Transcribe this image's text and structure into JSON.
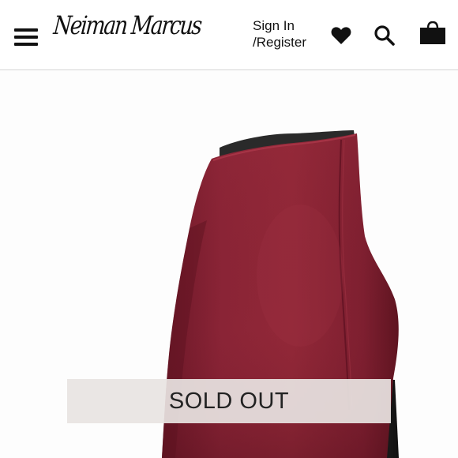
{
  "header": {
    "brand_logo_text": "Neiman Marcus",
    "sign_in_line1": "Sign In",
    "sign_in_line2": "/Register",
    "icons": {
      "menu": "hamburger-menu-icon",
      "wishlist": "heart-icon",
      "search": "search-icon",
      "cart": "shopping-bag-icon"
    }
  },
  "product": {
    "image_alt": "burgundy suede ankle boot",
    "status_label": "SOLD OUT"
  },
  "colors": {
    "boot_suede": "#8e2535",
    "boot_shadow": "#6a1525",
    "heel": "#1a1a1a",
    "banner_bg": "#e8e4e2",
    "text": "#111111"
  }
}
